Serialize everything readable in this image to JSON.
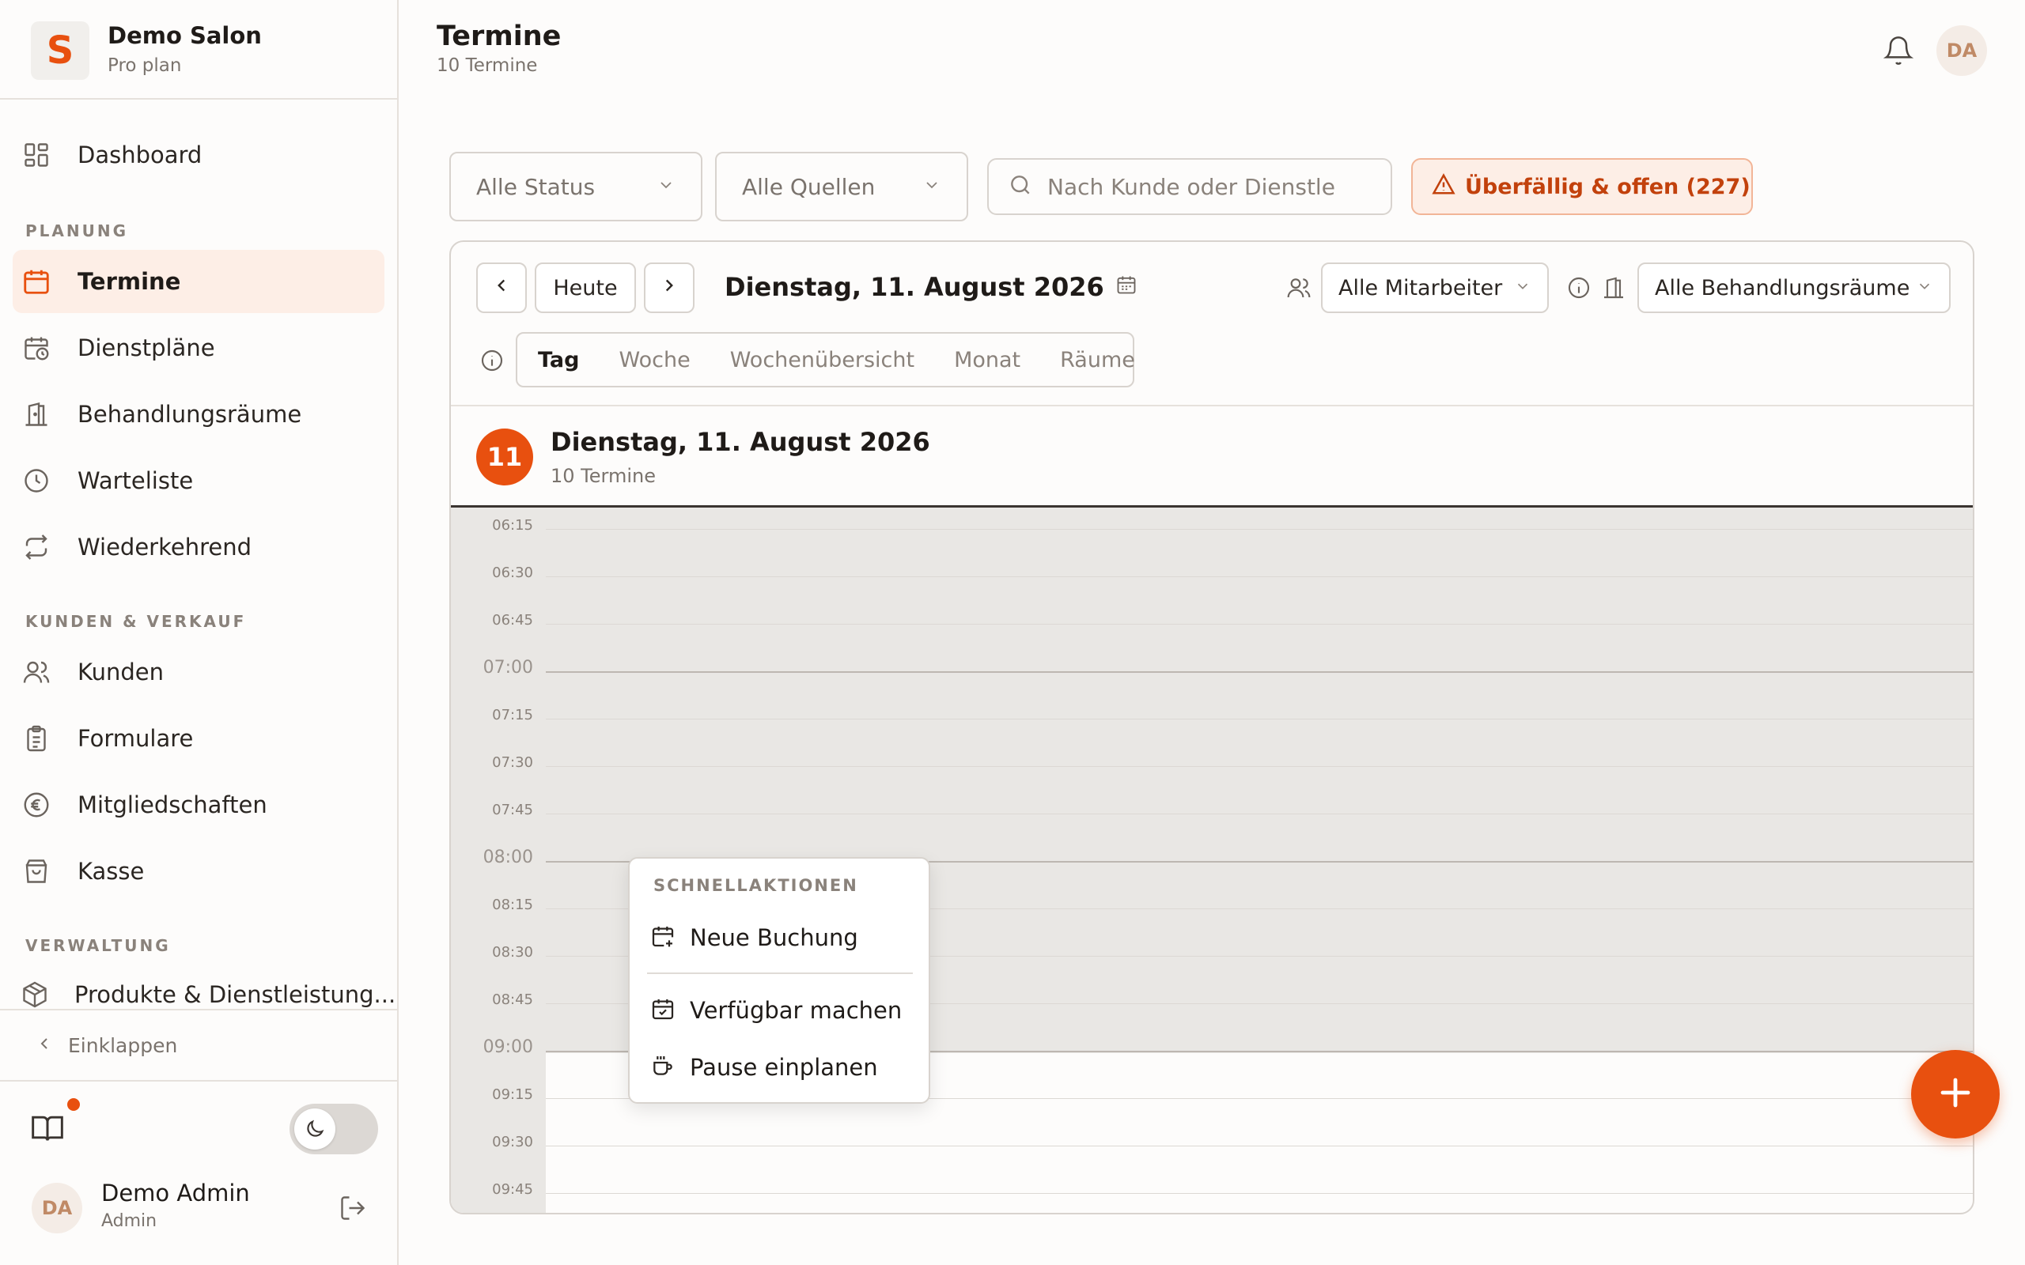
{
  "brand": {
    "name": "Demo Salon",
    "plan": "Pro plan",
    "logo_letter": "S"
  },
  "sidebar": {
    "dashboard": "Dashboard",
    "section_planning": "PLANUNG",
    "termine": "Termine",
    "dienstplaene": "Dienstpläne",
    "rooms": "Behandlungsräume",
    "waitlist": "Warteliste",
    "recurring": "Wiederkehrend",
    "section_customers": "KUNDEN & VERKAUF",
    "customers": "Kunden",
    "forms": "Formulare",
    "memberships": "Mitgliedschaften",
    "pos": "Kasse",
    "section_admin": "VERWALTUNG",
    "products": "Produkte & Dienstleistung...",
    "collapse": "Einklappen"
  },
  "user": {
    "initials": "DA",
    "name": "Demo Admin",
    "role": "Admin"
  },
  "header": {
    "title": "Termine",
    "subtitle": "10 Termine",
    "avatar_initials": "DA"
  },
  "filters": {
    "status": "Alle Status",
    "sources": "Alle Quellen",
    "search_placeholder": "Nach Kunde oder Dienstle",
    "overdue": "Überfällig & offen (227)"
  },
  "calendar": {
    "today": "Heute",
    "date_label": "Dienstag, 11. August 2026",
    "staff": "Alle Mitarbeiter",
    "rooms": "Alle Behandlungsräume",
    "tabs": [
      "Tag",
      "Woche",
      "Wochenübersicht",
      "Monat",
      "Räume"
    ],
    "day_number": "11",
    "day_title": "Dienstag, 11. August 2026",
    "day_sub": "10 Termine",
    "times": [
      "06:15",
      "06:30",
      "06:45",
      "07:00",
      "07:15",
      "07:30",
      "07:45",
      "08:00",
      "08:15",
      "08:30",
      "08:45",
      "09:00",
      "09:15",
      "09:30",
      "09:45"
    ]
  },
  "quick_menu": {
    "title": "SCHNELLAKTIONEN",
    "new_booking": "Neue Buchung",
    "make_available": "Verfügbar machen",
    "schedule_break": "Pause einplanen"
  },
  "colors": {
    "accent": "#e8500f",
    "accent_soft": "#fdeee6",
    "warning_text": "#c2410c"
  }
}
